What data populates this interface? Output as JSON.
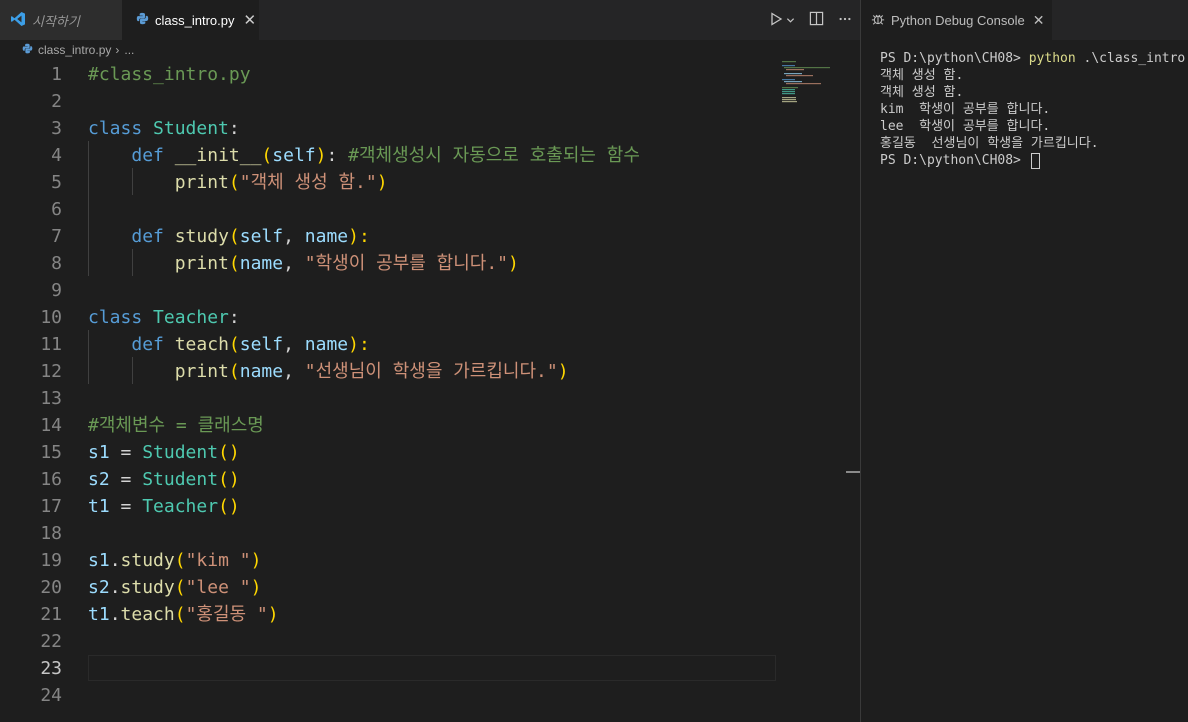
{
  "tabs": {
    "welcome": "시작하기",
    "active": "class_intro.py"
  },
  "breadcrumb": {
    "file": "class_intro.py",
    "more": "..."
  },
  "editor": {
    "current_line": 23,
    "lines": [
      [
        [
          "cm",
          "#class_intro.py"
        ]
      ],
      [],
      [
        [
          "kw",
          "class "
        ],
        [
          "cls",
          "Student"
        ],
        [
          "op",
          ":"
        ]
      ],
      [
        [
          "op",
          "    "
        ],
        [
          "kw",
          "def "
        ],
        [
          "fn",
          "__init__"
        ],
        [
          "br1",
          "("
        ],
        [
          "prm",
          "self"
        ],
        [
          "br1",
          ")"
        ],
        [
          "op",
          ": "
        ],
        [
          "cm",
          "#객체생성시 자동으로 호출되는 함수"
        ]
      ],
      [
        [
          "op",
          "        "
        ],
        [
          "fn",
          "print"
        ],
        [
          "br1",
          "("
        ],
        [
          "str",
          "\"객체 생성 함.\""
        ],
        [
          "br1",
          ")"
        ]
      ],
      [],
      [
        [
          "op",
          "    "
        ],
        [
          "kw",
          "def "
        ],
        [
          "fn",
          "study"
        ],
        [
          "br1",
          "("
        ],
        [
          "prm",
          "self"
        ],
        [
          "op",
          ", "
        ],
        [
          "prm",
          "name"
        ],
        [
          "br1",
          "):"
        ]
      ],
      [
        [
          "op",
          "        "
        ],
        [
          "fn",
          "print"
        ],
        [
          "br1",
          "("
        ],
        [
          "prm",
          "name"
        ],
        [
          "op",
          ", "
        ],
        [
          "str",
          "\"학생이 공부를 합니다.\""
        ],
        [
          "br1",
          ")"
        ]
      ],
      [],
      [
        [
          "kw",
          "class "
        ],
        [
          "cls",
          "Teacher"
        ],
        [
          "op",
          ":"
        ]
      ],
      [
        [
          "op",
          "    "
        ],
        [
          "kw",
          "def "
        ],
        [
          "fn",
          "teach"
        ],
        [
          "br1",
          "("
        ],
        [
          "prm",
          "self"
        ],
        [
          "op",
          ", "
        ],
        [
          "prm",
          "name"
        ],
        [
          "br1",
          "):"
        ]
      ],
      [
        [
          "op",
          "        "
        ],
        [
          "fn",
          "print"
        ],
        [
          "br1",
          "("
        ],
        [
          "prm",
          "name"
        ],
        [
          "op",
          ", "
        ],
        [
          "str",
          "\"선생님이 학생을 가르킵니다.\""
        ],
        [
          "br1",
          ")"
        ]
      ],
      [],
      [
        [
          "cm",
          "#객체변수 = 클래스명"
        ]
      ],
      [
        [
          "prm",
          "s1"
        ],
        [
          "op",
          " = "
        ],
        [
          "cls",
          "Student"
        ],
        [
          "br1",
          "()"
        ]
      ],
      [
        [
          "prm",
          "s2"
        ],
        [
          "op",
          " = "
        ],
        [
          "cls",
          "Student"
        ],
        [
          "br1",
          "()"
        ]
      ],
      [
        [
          "prm",
          "t1"
        ],
        [
          "op",
          " = "
        ],
        [
          "cls",
          "Teacher"
        ],
        [
          "br1",
          "()"
        ]
      ],
      [],
      [
        [
          "prm",
          "s1"
        ],
        [
          "op",
          "."
        ],
        [
          "fn",
          "study"
        ],
        [
          "br1",
          "("
        ],
        [
          "str",
          "\"kim \""
        ],
        [
          "br1",
          ")"
        ]
      ],
      [
        [
          "prm",
          "s2"
        ],
        [
          "op",
          "."
        ],
        [
          "fn",
          "study"
        ],
        [
          "br1",
          "("
        ],
        [
          "str",
          "\"lee \""
        ],
        [
          "br1",
          ")"
        ]
      ],
      [
        [
          "prm",
          "t1"
        ],
        [
          "op",
          "."
        ],
        [
          "fn",
          "teach"
        ],
        [
          "br1",
          "("
        ],
        [
          "str",
          "\"홍길동 \""
        ],
        [
          "br1",
          ")"
        ]
      ],
      [],
      [],
      []
    ]
  },
  "debug_panel": {
    "tab_label": "Python Debug Console",
    "prompt": "PS D:\\python\\CH08> ",
    "command": "python",
    "command_args": " .\\class_intro.py",
    "output": [
      "객체 생성 함.",
      "객체 생성 함.",
      "kim  학생이 공부를 합니다.",
      "lee  학생이 공부를 합니다.",
      "홍길동  선생님이 학생을 가르킵니다."
    ],
    "final_prompt": "PS D:\\python\\CH08> "
  },
  "icons": {
    "run": "play-icon",
    "split": "split-editor-icon",
    "more": "more-actions-icon",
    "python": "python-file-icon",
    "bug": "debug-bug-icon",
    "vscode": "vscode-logo-icon"
  }
}
